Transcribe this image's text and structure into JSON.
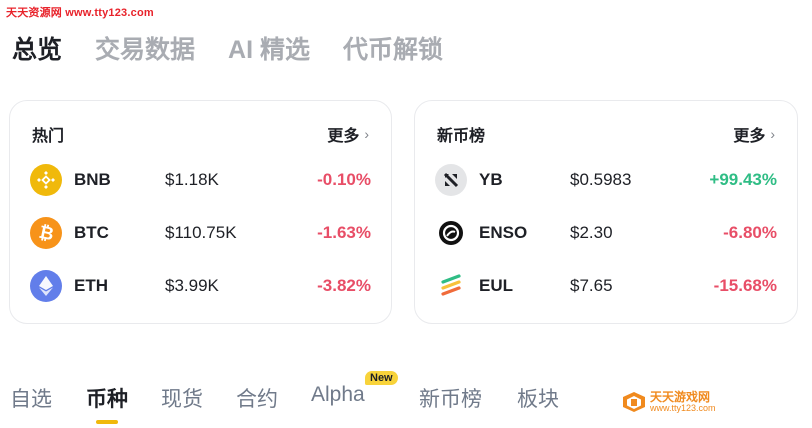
{
  "watermark": {
    "site": "天天资源网 www.tty123.com"
  },
  "top_tabs": [
    "总览",
    "交易数据",
    "AI 精选",
    "代币解锁"
  ],
  "hot": {
    "title": "热门",
    "more": "更多",
    "rows": [
      {
        "symbol": "BNB",
        "price": "$1.18K",
        "change": "-0.10%",
        "icon": "bnb-icon",
        "color": "#f0b90b"
      },
      {
        "symbol": "BTC",
        "price": "$110.75K",
        "change": "-1.63%",
        "icon": "btc-icon",
        "color": "#f7931a"
      },
      {
        "symbol": "ETH",
        "price": "$3.99K",
        "change": "-3.82%",
        "icon": "eth-icon",
        "color": "#627eea"
      }
    ]
  },
  "new_coins": {
    "title": "新币榜",
    "more": "更多",
    "rows": [
      {
        "symbol": "YB",
        "price": "$0.5983",
        "change": "+99.43%",
        "icon": "yb-icon"
      },
      {
        "symbol": "ENSO",
        "price": "$2.30",
        "change": "-6.80%",
        "icon": "enso-icon"
      },
      {
        "symbol": "EUL",
        "price": "$7.65",
        "change": "-15.68%",
        "icon": "eul-icon"
      }
    ]
  },
  "bottom_tabs": [
    "自选",
    "币种",
    "现货",
    "合约",
    "Alpha",
    "新币榜",
    "板块"
  ],
  "alpha_badge": "New",
  "logo_watermark": {
    "name": "天天游戏网",
    "url": "www.tty123.com"
  },
  "colors": {
    "down": "#e84e67",
    "up": "#2fbd85",
    "accent": "#f0b90b"
  }
}
